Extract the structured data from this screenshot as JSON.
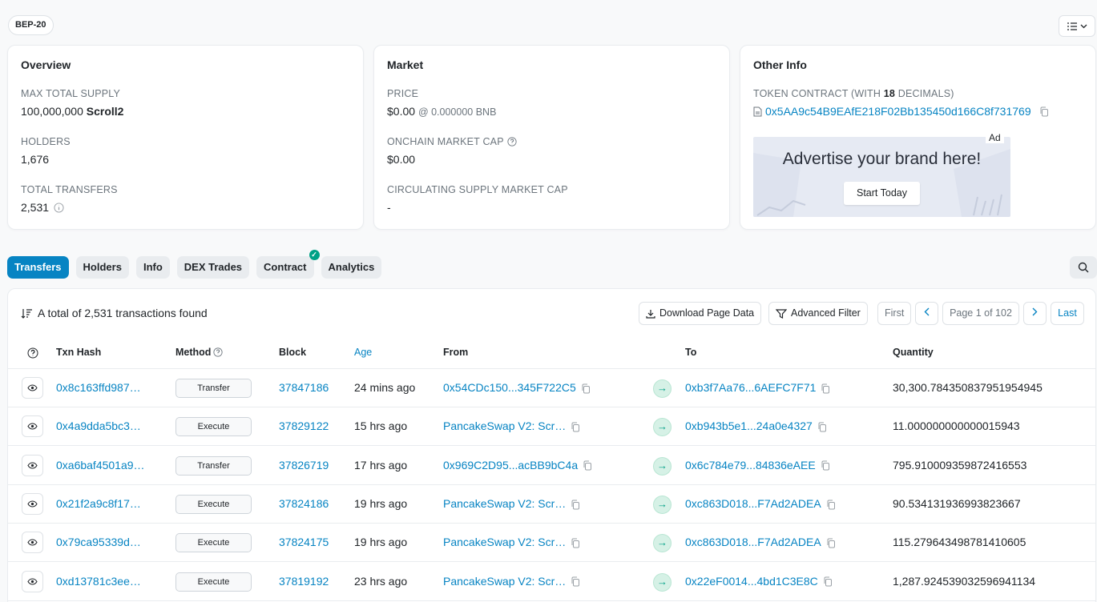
{
  "token_standard": "BEP-20",
  "overview": {
    "title": "Overview",
    "max_supply_label": "MAX TOTAL SUPPLY",
    "max_supply_value": "100,000,000",
    "max_supply_symbol": "Scroll2",
    "holders_label": "HOLDERS",
    "holders_value": "1,676",
    "transfers_label": "TOTAL TRANSFERS",
    "transfers_value": "2,531"
  },
  "market": {
    "title": "Market",
    "price_label": "PRICE",
    "price_value": "$0.00",
    "price_bnb": "@ 0.000000 BNB",
    "onchain_cap_label": "ONCHAIN MARKET CAP",
    "onchain_cap_value": "$0.00",
    "circ_cap_label": "CIRCULATING SUPPLY MARKET CAP",
    "circ_cap_value": "-"
  },
  "other": {
    "title": "Other Info",
    "contract_label_pre": "TOKEN CONTRACT (WITH ",
    "contract_decimals": "18",
    "contract_label_post": " DECIMALS)",
    "contract_address": "0x5AA9c54B9EAfE218F02Bb135450d166C8f731769",
    "ad_tag": "Ad",
    "ad_title": "Advertise your brand here!",
    "ad_button": "Start Today"
  },
  "tabs": [
    "Transfers",
    "Holders",
    "Info",
    "DEX Trades",
    "Contract",
    "Analytics"
  ],
  "table": {
    "summary": "A total of 2,531 transactions found",
    "download_label": "Download Page Data",
    "filter_label": "Advanced Filter",
    "first_label": "First",
    "page_label": "Page 1 of 102",
    "last_label": "Last",
    "headers": {
      "txn_hash": "Txn Hash",
      "method": "Method",
      "block": "Block",
      "age": "Age",
      "from": "From",
      "to": "To",
      "quantity": "Quantity"
    },
    "rows": [
      {
        "hash": "0x8c163ffd987…",
        "method": "Transfer",
        "block": "37847186",
        "age": "24 mins ago",
        "from": "0x54CDc150...345F722C5",
        "to": "0xb3f7Aa76...6AEFC7F71",
        "qty": "30,300.784350837951954945"
      },
      {
        "hash": "0x4a9dda5bc3…",
        "method": "Execute",
        "block": "37829122",
        "age": "15 hrs ago",
        "from": "PancakeSwap V2: Scr…",
        "to": "0xb943b5e1...24a0e4327",
        "qty": "11.000000000000015943"
      },
      {
        "hash": "0xa6baf4501a9…",
        "method": "Transfer",
        "block": "37826719",
        "age": "17 hrs ago",
        "from": "0x969C2D95...acBB9bC4a",
        "to": "0x6c784e79...84836eAEE",
        "qty": "795.910009359872416553"
      },
      {
        "hash": "0x21f2a9c8f17…",
        "method": "Execute",
        "block": "37824186",
        "age": "19 hrs ago",
        "from": "PancakeSwap V2: Scr…",
        "to": "0xc863D018...F7Ad2ADEA",
        "qty": "90.534131936993823667"
      },
      {
        "hash": "0x79ca95339d…",
        "method": "Execute",
        "block": "37824175",
        "age": "19 hrs ago",
        "from": "PancakeSwap V2: Scr…",
        "to": "0xc863D018...F7Ad2ADEA",
        "qty": "115.279643498781410605"
      },
      {
        "hash": "0xd13781c3ee…",
        "method": "Execute",
        "block": "37819192",
        "age": "23 hrs ago",
        "from": "PancakeSwap V2: Scr…",
        "to": "0x22eF0014...4bd1C3E8C",
        "qty": "1,287.924539032596941134"
      }
    ]
  },
  "colors": {
    "accent": "#0784c3",
    "success": "#00a186",
    "muted": "#6c757d"
  }
}
